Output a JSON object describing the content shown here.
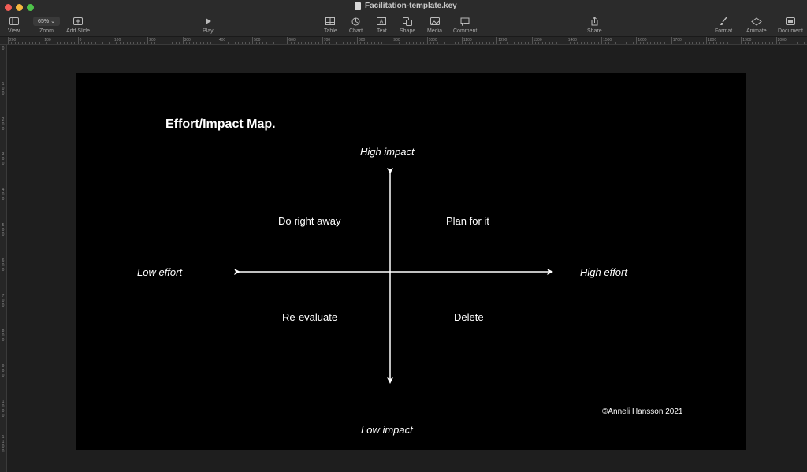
{
  "window": {
    "title": "Facilitation-template.key"
  },
  "toolbar": {
    "view": "View",
    "zoom_value": "65%",
    "zoom": "Zoom",
    "add_slide": "Add Slide",
    "play": "Play",
    "table": "Table",
    "chart": "Chart",
    "text": "Text",
    "shape": "Shape",
    "media": "Media",
    "comment": "Comment",
    "share": "Share",
    "format": "Format",
    "animate": "Animate",
    "document": "Document"
  },
  "ruler": {
    "h_labels": [
      "200",
      "100",
      "0",
      "100",
      "200",
      "300",
      "400",
      "500",
      "600",
      "700",
      "800",
      "900",
      "1000",
      "1100",
      "1200",
      "1300",
      "1400",
      "1500",
      "1600",
      "1700",
      "1800",
      "1900",
      "2000"
    ],
    "v_labels": [
      "0",
      "100",
      "200",
      "300",
      "400",
      "500",
      "600",
      "700",
      "800",
      "900",
      "1000",
      "1100"
    ]
  },
  "slide": {
    "title": "Effort/Impact Map.",
    "high_impact": "High impact",
    "low_impact": "Low impact",
    "low_effort": "Low effort",
    "high_effort": "High effort",
    "quadrants": {
      "top_left": "Do right away",
      "top_right": "Plan for it",
      "bottom_left": "Re-evaluate",
      "bottom_right": "Delete"
    },
    "copyright": "©Anneli Hansson 2021"
  }
}
